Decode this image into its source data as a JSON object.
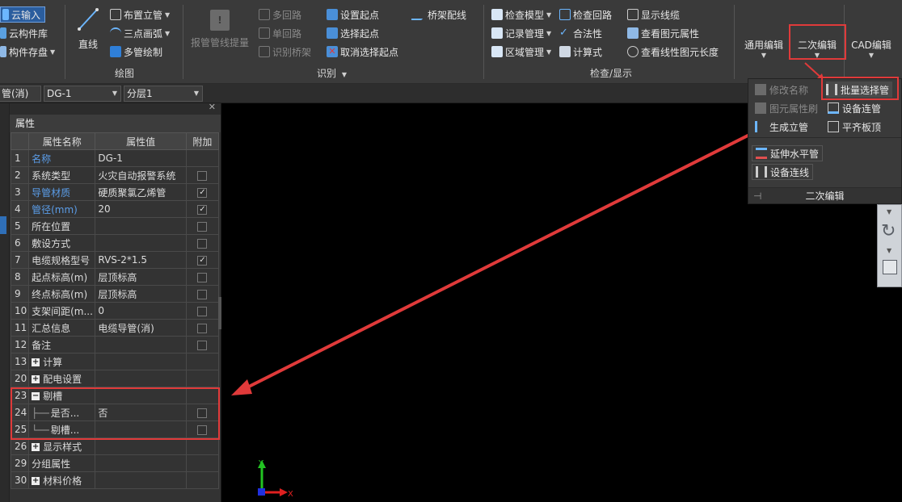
{
  "ribbon": {
    "col1": {
      "cloud_input": "云输入",
      "cloud_lib": "云构件库",
      "comp_save": "构件存盘"
    },
    "draw": {
      "line": "直线",
      "place_riser": "布置立管",
      "arc3": "三点画弧",
      "multi_pipe": "多管绘制",
      "group": "绘图"
    },
    "recognize": {
      "alarm_pipe": "报管管线提量",
      "multi_loop": "多回路",
      "single_loop": "单回路",
      "recog_bridge": "识别桥架",
      "set_start": "设置起点",
      "select_start": "选择起点",
      "cancel_start": "取消选择起点",
      "bridge_wire": "桥架配线",
      "group": "识别"
    },
    "check": {
      "check_model": "检查模型",
      "record_mgmt": "记录管理",
      "region_mgmt": "区域管理",
      "check_loop": "检查回路",
      "legality": "合法性",
      "calc": "计算式",
      "show_lines": "显示线缆",
      "view_props": "查看图元属性",
      "view_length": "查看线性图元长度",
      "group": "检查/显示"
    },
    "edit": {
      "general": "通用编辑",
      "secondary": "二次编辑",
      "cad": "CAD编辑"
    }
  },
  "toolbar2": {
    "combo1": "管(消)",
    "combo2": "DG-1",
    "combo3": "分层1"
  },
  "props": {
    "title": "属性",
    "headers": [
      "属性名称",
      "属性值",
      "附加"
    ],
    "rows": [
      {
        "n": "1",
        "name": "名称",
        "val": "DG-1",
        "blue": true,
        "chk": null
      },
      {
        "n": "2",
        "name": "系统类型",
        "val": "火灾自动报警系统",
        "blue": false,
        "chk": false
      },
      {
        "n": "3",
        "name": "导管材质",
        "val": "硬质聚氯乙烯管",
        "blue": true,
        "chk": true
      },
      {
        "n": "4",
        "name": "管径(mm)",
        "val": "20",
        "blue": true,
        "chk": true
      },
      {
        "n": "5",
        "name": "所在位置",
        "val": "",
        "blue": false,
        "chk": false
      },
      {
        "n": "6",
        "name": "敷设方式",
        "val": "",
        "blue": false,
        "chk": false
      },
      {
        "n": "7",
        "name": "电缆规格型号",
        "val": "RVS-2*1.5",
        "blue": false,
        "chk": true
      },
      {
        "n": "8",
        "name": "起点标高(m)",
        "val": "层顶标高",
        "blue": false,
        "chk": false
      },
      {
        "n": "9",
        "name": "终点标高(m)",
        "val": "层顶标高",
        "blue": false,
        "chk": false
      },
      {
        "n": "10",
        "name": "支架间距(m...",
        "val": "0",
        "blue": false,
        "chk": false
      },
      {
        "n": "11",
        "name": "汇总信息",
        "val": "电缆导管(消)",
        "blue": false,
        "chk": false
      },
      {
        "n": "12",
        "name": "备注",
        "val": "",
        "blue": false,
        "chk": false
      },
      {
        "n": "13",
        "name": "计算",
        "val": "",
        "blue": false,
        "chk": null,
        "exp": "+"
      },
      {
        "n": "20",
        "name": "配电设置",
        "val": "",
        "blue": false,
        "chk": null,
        "exp": "+"
      },
      {
        "n": "23",
        "name": "剔槽",
        "val": "",
        "blue": false,
        "chk": null,
        "exp": "−"
      },
      {
        "n": "24",
        "name": "是否...",
        "val": "否",
        "blue": false,
        "chk": false,
        "tree": "├──"
      },
      {
        "n": "25",
        "name": "剔槽...",
        "val": "",
        "blue": false,
        "chk": false,
        "tree": "└──"
      },
      {
        "n": "26",
        "name": "显示样式",
        "val": "",
        "blue": false,
        "chk": null,
        "exp": "+"
      },
      {
        "n": "29",
        "name": "分组属性",
        "val": "",
        "blue": false,
        "chk": null
      },
      {
        "n": "30",
        "name": "材料价格",
        "val": "",
        "blue": false,
        "chk": null,
        "exp": "+"
      }
    ]
  },
  "dropdown": {
    "modify_name": "修改名称",
    "batch_select": "批量选择管",
    "brush": "图元属性刷",
    "equip_conn": "设备连管",
    "gen_riser": "生成立管",
    "flush_top": "平齐板顶",
    "extend_h": "延伸水平管",
    "equip_wire": "设备连线",
    "footer": "二次编辑"
  },
  "axes": {
    "x": "X",
    "y": "Y"
  },
  "colors": {
    "highlight": "#e03a3a",
    "link_blue": "#5b9de8"
  }
}
